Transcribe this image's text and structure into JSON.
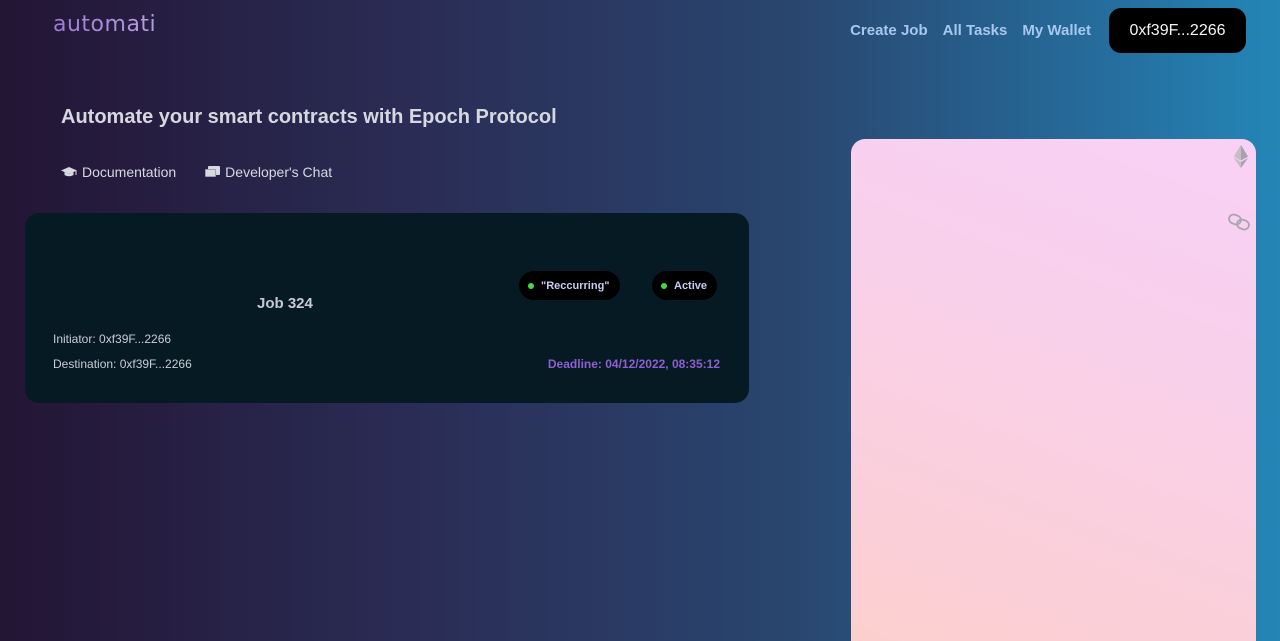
{
  "brand": {
    "logo_text": "automati",
    "color": "#a98ad8"
  },
  "nav": {
    "links": [
      {
        "label": "Create Job"
      },
      {
        "label": "All Tasks"
      },
      {
        "label": "My Wallet"
      }
    ],
    "wallet_address": "0xf39F...2266"
  },
  "hero": {
    "headline": "Automate your smart contracts with Epoch Protocol"
  },
  "resources": {
    "documentation_label": "Documentation",
    "documentation_icon": "graduation-cap-icon",
    "chat_label": "Developer's Chat",
    "chat_icon": "chat-icon"
  },
  "job": {
    "title": "Job 324",
    "type_badge": "\"Reccurring\"",
    "status_badge": "Active",
    "status_color": "#46d84a",
    "initiator": "Initiator: 0xf39F...2266",
    "destination": "Destination: 0xf39F...2266",
    "deadline": "Deadline: 04/12/2022, 08:35:12",
    "deadline_color": "#8e5fd0"
  },
  "side_panel": {
    "icons": [
      "ethereum-icon",
      "link-icon"
    ]
  },
  "colors": {
    "accent_link": "#a7c7ee",
    "card_bg": "#061a24",
    "panel_pink": "#f9d0ea"
  }
}
